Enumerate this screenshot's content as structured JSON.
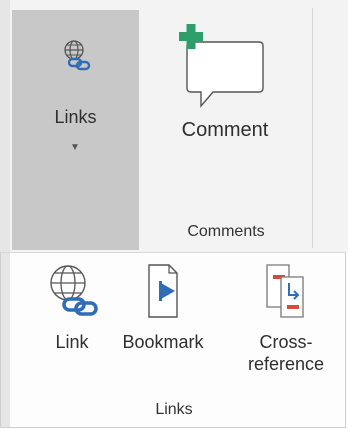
{
  "ribbon": {
    "links_button": {
      "label": "Links",
      "icon": "links-globe-chain-icon",
      "dropdown_icon": "caret-down-icon"
    },
    "comment_button": {
      "label": "Comment",
      "icon": "new-comment-icon"
    },
    "comments_group_label": "Comments"
  },
  "links_popup": {
    "buttons": [
      {
        "label": "Link",
        "icon": "link-globe-icon"
      },
      {
        "label": "Bookmark",
        "icon": "bookmark-icon"
      },
      {
        "label_line1": "Cross-",
        "label_line2": "reference",
        "icon": "cross-reference-icon"
      }
    ],
    "group_label": "Links"
  },
  "colors": {
    "accent_green": "#2e9e6a",
    "chain_blue": "#2f6db5",
    "red": "#d94a3d",
    "selected_bg": "#c8c8c8"
  }
}
